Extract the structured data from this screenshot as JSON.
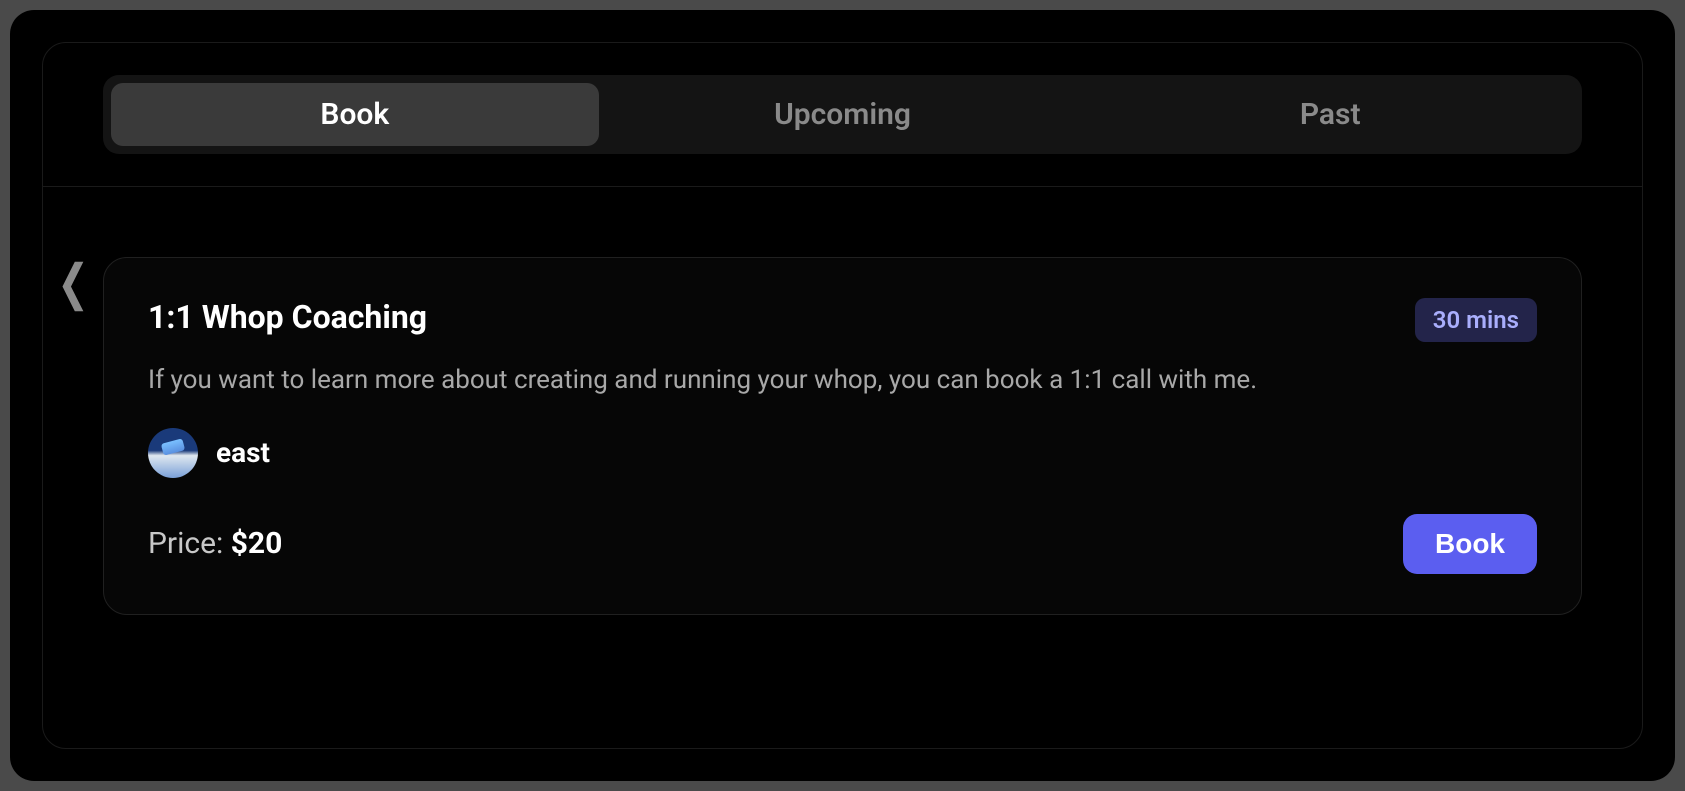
{
  "tabs": {
    "book": "Book",
    "upcoming": "Upcoming",
    "past": "Past",
    "active": "book"
  },
  "listing": {
    "title": "1:1 Whop Coaching",
    "duration_badge": "30 mins",
    "description": "If you want to learn more about creating and running your whop, you can book a 1:1 call with me.",
    "host_name": "east",
    "price_label": "Price:",
    "price_value": "$20",
    "book_button": "Book"
  }
}
